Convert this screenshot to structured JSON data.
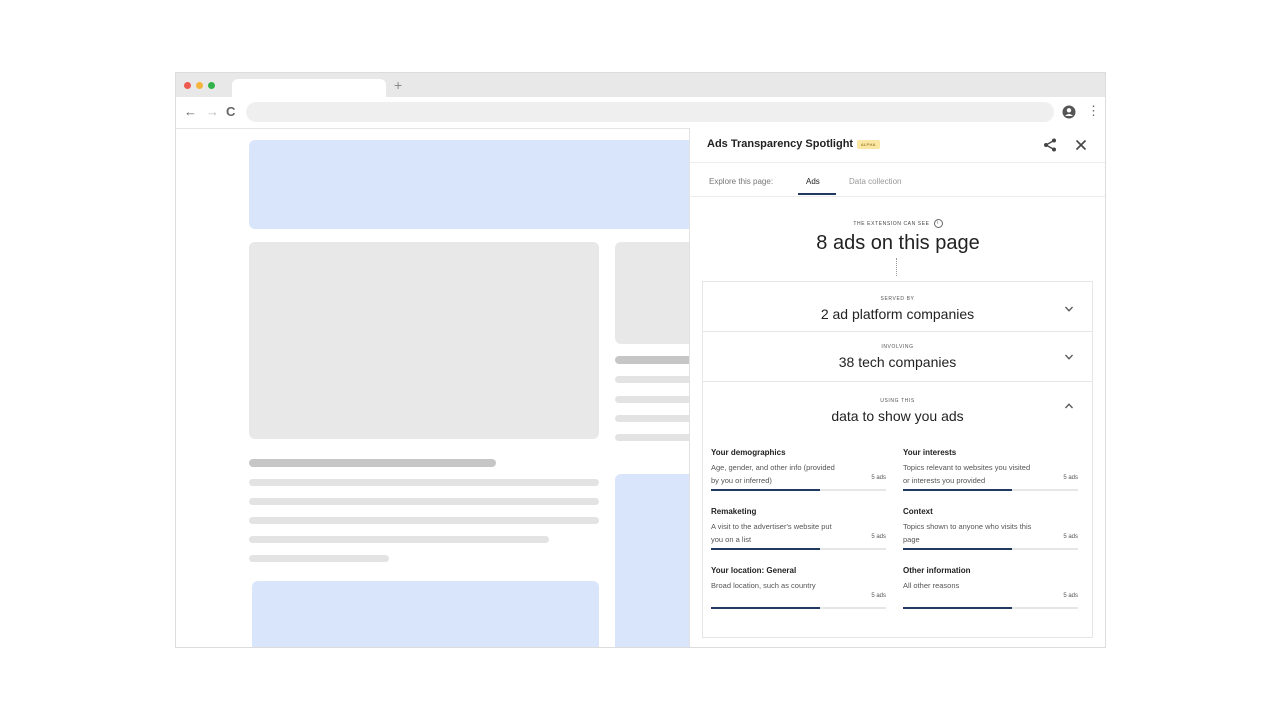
{
  "browser": {
    "dot_colors": [
      "#ef5a50",
      "#f5b53a",
      "#34b34a"
    ],
    "new_tab_glyph": "+",
    "back_glyph": "←",
    "forward_glyph": "→",
    "reload_glyph": "C",
    "menu_glyph": "⋮"
  },
  "panel": {
    "title": "Ads Transparency Spotlight",
    "badge": "ALPHA",
    "tabs_label": "Explore this page:",
    "tabs": [
      {
        "label": "Ads",
        "active": true
      },
      {
        "label": "Data collection",
        "active": false
      }
    ],
    "summary": {
      "caption": "THE EXTENSION CAN SEE",
      "value": "8 ads on this page"
    },
    "sections": [
      {
        "caption": "SERVED BY",
        "value": "2 ad platform companies",
        "expanded": false
      },
      {
        "caption": "INVOLVING",
        "value": "38 tech companies",
        "expanded": false
      },
      {
        "caption": "USING THIS",
        "value": "data to show you ads",
        "expanded": true
      }
    ],
    "reasons": [
      {
        "title": "Your demographics",
        "desc": "Age, gender, and other info (provided by you or inferred)",
        "count": "5 ads",
        "fill": 0.62
      },
      {
        "title": "Your interests",
        "desc": "Topics relevant to websites you visited or interests you provided",
        "count": "5 ads",
        "fill": 0.62
      },
      {
        "title": "Remaketing",
        "desc": "A visit to the advertiser's website put you on a list",
        "count": "5 ads",
        "fill": 0.62
      },
      {
        "title": "Context",
        "desc": "Topics shown to anyone who visits this page",
        "count": "5 ads",
        "fill": 0.62
      },
      {
        "title": "Your location: General",
        "desc": "Broad location, such as country",
        "count": "5 ads",
        "fill": 0.62
      },
      {
        "title": "Other information",
        "desc": "All other reasons",
        "count": "5 ads",
        "fill": 0.62
      }
    ],
    "accent_color": "#203a60"
  }
}
